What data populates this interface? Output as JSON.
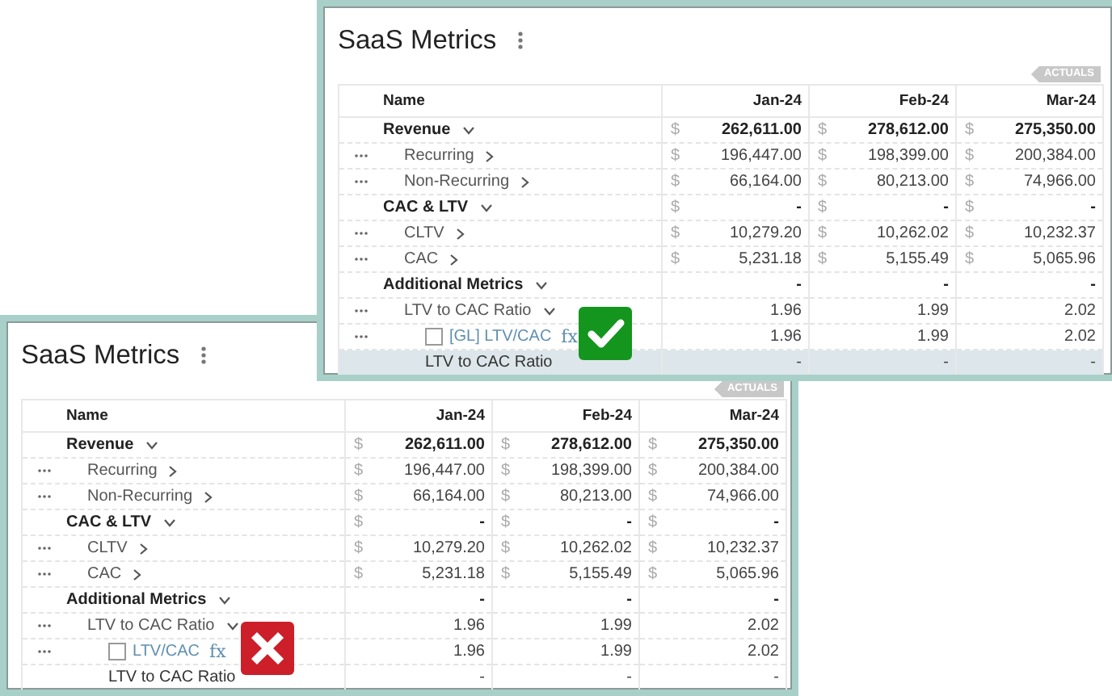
{
  "windows": [
    {
      "title": "SaaS Metrics",
      "badge": "ACTUALS",
      "correct": true,
      "columns": [
        "Name",
        "Jan-24",
        "Feb-24",
        "Mar-24"
      ],
      "rows": [
        {
          "kind": "group",
          "name": "Revenue",
          "expanded": true,
          "values": [
            {
              "currency": "$",
              "amount": "262,611.00"
            },
            {
              "currency": "$",
              "amount": "278,612.00"
            },
            {
              "currency": "$",
              "amount": "275,350.00"
            }
          ],
          "children": [
            {
              "kind": "item",
              "name": "Recurring",
              "expanded": false,
              "values": [
                {
                  "currency": "$",
                  "amount": "196,447.00"
                },
                {
                  "currency": "$",
                  "amount": "198,399.00"
                },
                {
                  "currency": "$",
                  "amount": "200,384.00"
                }
              ]
            },
            {
              "kind": "item",
              "name": "Non-Recurring",
              "expanded": false,
              "values": [
                {
                  "currency": "$",
                  "amount": "66,164.00"
                },
                {
                  "currency": "$",
                  "amount": "80,213.00"
                },
                {
                  "currency": "$",
                  "amount": "74,966.00"
                }
              ]
            }
          ]
        },
        {
          "kind": "group",
          "name": "CAC & LTV",
          "expanded": true,
          "values": [
            {
              "currency": "$",
              "amount": "-"
            },
            {
              "currency": "$",
              "amount": "-"
            },
            {
              "currency": "$",
              "amount": "-"
            }
          ],
          "children": [
            {
              "kind": "item",
              "name": "CLTV",
              "expanded": false,
              "values": [
                {
                  "currency": "$",
                  "amount": "10,279.20"
                },
                {
                  "currency": "$",
                  "amount": "10,262.02"
                },
                {
                  "currency": "$",
                  "amount": "10,232.37"
                }
              ]
            },
            {
              "kind": "item",
              "name": "CAC",
              "expanded": false,
              "values": [
                {
                  "currency": "$",
                  "amount": "5,231.18"
                },
                {
                  "currency": "$",
                  "amount": "5,155.49"
                },
                {
                  "currency": "$",
                  "amount": "5,065.96"
                }
              ]
            }
          ]
        },
        {
          "kind": "group",
          "name": "Additional Metrics",
          "expanded": true,
          "values": [
            {
              "amount": "-"
            },
            {
              "amount": "-"
            },
            {
              "amount": "-"
            }
          ],
          "children": [
            {
              "kind": "item",
              "name": "LTV to CAC Ratio",
              "expanded": true,
              "values": [
                {
                  "amount": "1.96"
                },
                {
                  "amount": "1.99"
                },
                {
                  "amount": "2.02"
                }
              ],
              "children": [
                {
                  "kind": "formula",
                  "name": "[GL] LTV/CAC",
                  "formula_mark": "fx",
                  "checked": false,
                  "values": [
                    {
                      "amount": "1.96"
                    },
                    {
                      "amount": "1.99"
                    },
                    {
                      "amount": "2.02"
                    }
                  ]
                },
                {
                  "kind": "summary",
                  "name": "LTV to CAC Ratio",
                  "highlighted": true,
                  "values": [
                    {
                      "amount": "-"
                    },
                    {
                      "amount": "-"
                    },
                    {
                      "amount": "-"
                    }
                  ]
                }
              ]
            }
          ]
        }
      ]
    },
    {
      "title": "SaaS Metrics",
      "badge": "ACTUALS",
      "correct": false,
      "columns": [
        "Name",
        "Jan-24",
        "Feb-24",
        "Mar-24"
      ],
      "rows": [
        {
          "kind": "group",
          "name": "Revenue",
          "expanded": true,
          "values": [
            {
              "currency": "$",
              "amount": "262,611.00"
            },
            {
              "currency": "$",
              "amount": "278,612.00"
            },
            {
              "currency": "$",
              "amount": "275,350.00"
            }
          ],
          "children": [
            {
              "kind": "item",
              "name": "Recurring",
              "expanded": false,
              "values": [
                {
                  "currency": "$",
                  "amount": "196,447.00"
                },
                {
                  "currency": "$",
                  "amount": "198,399.00"
                },
                {
                  "currency": "$",
                  "amount": "200,384.00"
                }
              ]
            },
            {
              "kind": "item",
              "name": "Non-Recurring",
              "expanded": false,
              "values": [
                {
                  "currency": "$",
                  "amount": "66,164.00"
                },
                {
                  "currency": "$",
                  "amount": "80,213.00"
                },
                {
                  "currency": "$",
                  "amount": "74,966.00"
                }
              ]
            }
          ]
        },
        {
          "kind": "group",
          "name": "CAC & LTV",
          "expanded": true,
          "values": [
            {
              "currency": "$",
              "amount": "-"
            },
            {
              "currency": "$",
              "amount": "-"
            },
            {
              "currency": "$",
              "amount": "-"
            }
          ],
          "children": [
            {
              "kind": "item",
              "name": "CLTV",
              "expanded": false,
              "values": [
                {
                  "currency": "$",
                  "amount": "10,279.20"
                },
                {
                  "currency": "$",
                  "amount": "10,262.02"
                },
                {
                  "currency": "$",
                  "amount": "10,232.37"
                }
              ]
            },
            {
              "kind": "item",
              "name": "CAC",
              "expanded": false,
              "values": [
                {
                  "currency": "$",
                  "amount": "5,231.18"
                },
                {
                  "currency": "$",
                  "amount": "5,155.49"
                },
                {
                  "currency": "$",
                  "amount": "5,065.96"
                }
              ]
            }
          ]
        },
        {
          "kind": "group",
          "name": "Additional Metrics",
          "expanded": true,
          "values": [
            {
              "amount": "-"
            },
            {
              "amount": "-"
            },
            {
              "amount": "-"
            }
          ],
          "children": [
            {
              "kind": "item",
              "name": "LTV to CAC Ratio",
              "expanded": true,
              "values": [
                {
                  "amount": "1.96"
                },
                {
                  "amount": "1.99"
                },
                {
                  "amount": "2.02"
                }
              ],
              "children": [
                {
                  "kind": "formula",
                  "name": "LTV/CAC",
                  "formula_mark": "fx",
                  "checked": false,
                  "values": [
                    {
                      "amount": "1.96"
                    },
                    {
                      "amount": "1.99"
                    },
                    {
                      "amount": "2.02"
                    }
                  ]
                },
                {
                  "kind": "summary",
                  "name": "LTV to CAC Ratio",
                  "highlighted": false,
                  "values": [
                    {
                      "amount": "-"
                    },
                    {
                      "amount": "-"
                    },
                    {
                      "amount": "-"
                    }
                  ]
                }
              ]
            }
          ]
        }
      ]
    }
  ]
}
